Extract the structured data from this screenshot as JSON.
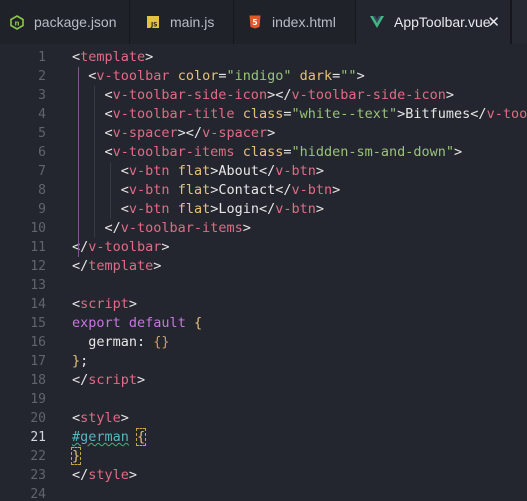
{
  "tabs": [
    {
      "label": "package.json",
      "icon": "node-icon"
    },
    {
      "label": "main.js",
      "icon": "js-icon"
    },
    {
      "label": "index.html",
      "icon": "html5-icon"
    },
    {
      "label": "AppToolbar.vue",
      "icon": "vue-icon",
      "active": true
    }
  ],
  "editor": {
    "current_line": 21,
    "line_numbers": [
      "1",
      "2",
      "3",
      "4",
      "5",
      "6",
      "7",
      "8",
      "9",
      "10",
      "11",
      "12",
      "13",
      "14",
      "15",
      "16",
      "17",
      "18",
      "19",
      "20",
      "21",
      "22",
      "23",
      "24"
    ],
    "lines": [
      [
        [
          "p",
          "<"
        ],
        [
          "t",
          "template"
        ],
        [
          "p",
          ">"
        ]
      ],
      [
        [
          "p",
          "  <"
        ],
        [
          "t",
          "v-toolbar"
        ],
        [
          "p",
          " "
        ],
        [
          "a",
          "color"
        ],
        [
          "p",
          "="
        ],
        [
          "s",
          "\"indigo\""
        ],
        [
          "p",
          " "
        ],
        [
          "a",
          "dark"
        ],
        [
          "p",
          "="
        ],
        [
          "s",
          "\"\""
        ],
        [
          "p",
          ">"
        ]
      ],
      [
        [
          "p",
          "    <"
        ],
        [
          "t",
          "v-toolbar-side-icon"
        ],
        [
          "p",
          "></"
        ],
        [
          "t",
          "v-toolbar-side-icon"
        ],
        [
          "p",
          ">"
        ]
      ],
      [
        [
          "p",
          "    <"
        ],
        [
          "t",
          "v-toolbar-title"
        ],
        [
          "p",
          " "
        ],
        [
          "a",
          "class"
        ],
        [
          "p",
          "="
        ],
        [
          "s",
          "\"white--text\""
        ],
        [
          "p",
          ">Bitfumes</"
        ],
        [
          "t",
          "v-toolbar-title"
        ],
        [
          "p",
          ">"
        ]
      ],
      [
        [
          "p",
          "    <"
        ],
        [
          "t",
          "v-spacer"
        ],
        [
          "p",
          "></"
        ],
        [
          "t",
          "v-spacer"
        ],
        [
          "p",
          ">"
        ]
      ],
      [
        [
          "p",
          "    <"
        ],
        [
          "t",
          "v-toolbar-items"
        ],
        [
          "p",
          " "
        ],
        [
          "a",
          "class"
        ],
        [
          "p",
          "="
        ],
        [
          "s",
          "\"hidden-sm-and-down\""
        ],
        [
          "p",
          ">"
        ]
      ],
      [
        [
          "p",
          "      <"
        ],
        [
          "t",
          "v-btn"
        ],
        [
          "p",
          " "
        ],
        [
          "a",
          "flat"
        ],
        [
          "p",
          ">About</"
        ],
        [
          "t",
          "v-btn"
        ],
        [
          "p",
          ">"
        ]
      ],
      [
        [
          "p",
          "      <"
        ],
        [
          "t",
          "v-btn"
        ],
        [
          "p",
          " "
        ],
        [
          "a",
          "flat"
        ],
        [
          "p",
          ">Contact</"
        ],
        [
          "t",
          "v-btn"
        ],
        [
          "p",
          ">"
        ]
      ],
      [
        [
          "p",
          "      <"
        ],
        [
          "t",
          "v-btn"
        ],
        [
          "p",
          " "
        ],
        [
          "a",
          "flat"
        ],
        [
          "p",
          ">Login</"
        ],
        [
          "t",
          "v-btn"
        ],
        [
          "p",
          ">"
        ]
      ],
      [
        [
          "p",
          "    </"
        ],
        [
          "t",
          "v-toolbar-items"
        ],
        [
          "p",
          ">"
        ]
      ],
      [
        [
          "p",
          "</"
        ],
        [
          "t",
          "v-toolbar"
        ],
        [
          "p",
          ">"
        ]
      ],
      [
        [
          "p",
          "</"
        ],
        [
          "t",
          "template"
        ],
        [
          "p",
          ">"
        ]
      ],
      [],
      [
        [
          "p",
          "<"
        ],
        [
          "t",
          "script"
        ],
        [
          "p",
          ">"
        ]
      ],
      [
        [
          "kw",
          "export"
        ],
        [
          "p",
          " "
        ],
        [
          "kw",
          "default"
        ],
        [
          "p",
          " "
        ],
        [
          "b",
          "{"
        ]
      ],
      [
        [
          "p",
          "  german"
        ],
        [
          "p",
          ": "
        ],
        [
          "br",
          "{}"
        ]
      ],
      [
        [
          "b",
          "}"
        ],
        [
          "p",
          ";"
        ]
      ],
      [
        [
          "p",
          "</"
        ],
        [
          "t",
          "script"
        ],
        [
          "p",
          ">"
        ]
      ],
      [],
      [
        [
          "p",
          "<"
        ],
        [
          "t",
          "style"
        ],
        [
          "p",
          ">"
        ]
      ],
      [
        [
          "id",
          "#german"
        ],
        [
          "p",
          " "
        ],
        [
          "b",
          "{"
        ]
      ],
      [
        [
          "b",
          "}"
        ]
      ],
      [
        [
          "p",
          "</"
        ],
        [
          "t",
          "style"
        ],
        [
          "p",
          ">"
        ]
      ],
      []
    ]
  }
}
